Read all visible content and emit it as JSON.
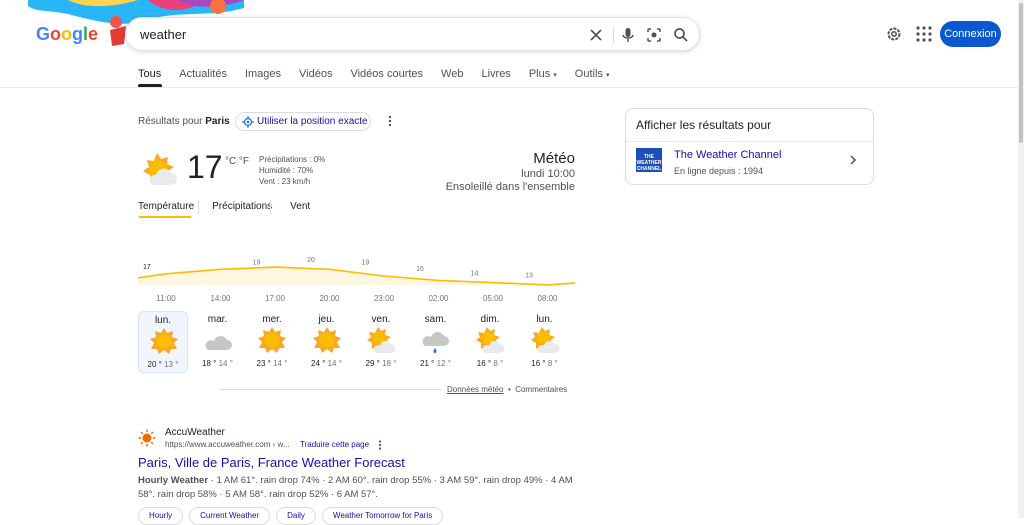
{
  "header": {
    "logo_text": "Google",
    "search_value": "weather",
    "signin_label": "Connexion"
  },
  "tabs": [
    "Tous",
    "Actualités",
    "Images",
    "Vidéos",
    "Vidéos courtes",
    "Web",
    "Livres",
    "Plus",
    "Outils"
  ],
  "location": {
    "prefix": "Résultats pour",
    "city": "Paris",
    "use_precise_label": "Utiliser la position exacte"
  },
  "weather": {
    "temperature": "17",
    "unit_c": "°C",
    "unit_sep": "|",
    "unit_f": "°F",
    "precipitation": "Précipitations : 0%",
    "humidity": "Humidité : 70%",
    "wind": "Vent : 23 km/h",
    "title": "Météo",
    "time": "lundi 10:00",
    "condition": "Ensoleillé dans l'ensemble",
    "tabs": [
      "Température",
      "Précipitations",
      "Vent"
    ],
    "footer_source": "Données météo",
    "footer_dot": "•",
    "footer_feedback": "Commentaires",
    "days": [
      {
        "name": "lun.",
        "hi": "20 °",
        "lo": "13 °",
        "icon": "sun-icon"
      },
      {
        "name": "mar.",
        "hi": "18 °",
        "lo": "14 °",
        "icon": "cloud-icon"
      },
      {
        "name": "mer.",
        "hi": "23 °",
        "lo": "14 °",
        "icon": "sun-icon"
      },
      {
        "name": "jeu.",
        "hi": "24 °",
        "lo": "14 °",
        "icon": "sun-icon"
      },
      {
        "name": "ven.",
        "hi": "29 °",
        "lo": "18 °",
        "icon": "partly-sunny-icon"
      },
      {
        "name": "sam.",
        "hi": "21 °",
        "lo": "12 °",
        "icon": "rain-icon"
      },
      {
        "name": "dim.",
        "hi": "16 °",
        "lo": "8 °",
        "icon": "partly-sunny-icon"
      },
      {
        "name": "lun.",
        "hi": "16 °",
        "lo": "8 °",
        "icon": "partly-sunny-icon"
      }
    ]
  },
  "chart_data": {
    "type": "area",
    "x": [
      "11:00",
      "14:00",
      "17:00",
      "20:00",
      "23:00",
      "02:00",
      "05:00",
      "08:00"
    ],
    "values": [
      17,
      19,
      20,
      19,
      16,
      14,
      13,
      12
    ],
    "ylim": [
      0,
      25
    ],
    "grid": false,
    "colors": {
      "line": "#fbbc04",
      "fill": "#fef7e0"
    }
  },
  "side_panel": {
    "title": "Afficher les résultats pour",
    "logo_text": "THE WEATHER CHANNEL",
    "link": "The Weather Channel",
    "subtitle": "En ligne depuis : 1994"
  },
  "result": {
    "site_name": "AccuWeather",
    "url": "https://www.accuweather.com › w...",
    "translate_label": "Traduire cette page",
    "title": "Paris, Ville de Paris, France Weather Forecast",
    "snippet_bold": "Hourly Weather",
    "snippet_line1": " · 1 AM 61°. rain drop 74% · 2 AM 60°. rain drop 55% · 3 AM 59°. rain drop 49% · 4 AM",
    "snippet_line2": "58°. rain drop 58% · 5 AM 58°. rain drop 52% · 6 AM 57°.",
    "chips": [
      "Hourly",
      "Current Weather",
      "Daily",
      "Weather Tomorrow for Paris"
    ]
  },
  "colors": {
    "accent": "#0b57d0",
    "link": "#1a0dab",
    "sun": "#f9a825",
    "chart_line": "#fbbc04"
  }
}
